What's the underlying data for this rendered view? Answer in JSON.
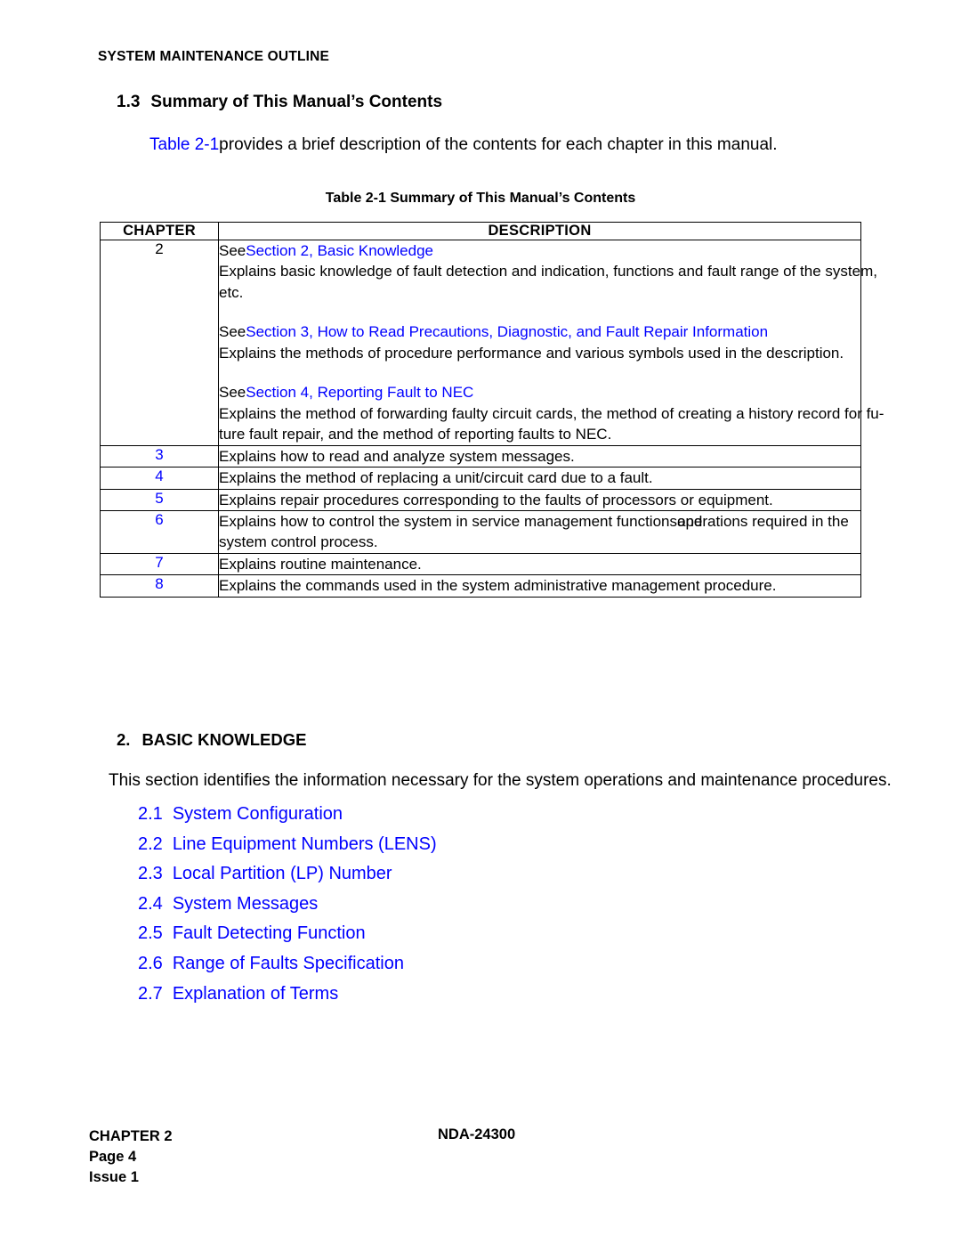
{
  "running_head": "SYSTEM MAINTENANCE OUTLINE",
  "section": {
    "number": "1.3",
    "title": "Summary of This Manual’s Contents"
  },
  "intro": {
    "link": "Table 2-1",
    "rest": "provides a brief description of the contents for each chapter in this manual."
  },
  "table": {
    "caption": "Table 2-1  Summary of This Manual’s Contents",
    "headers": {
      "chapter": "CHAPTER",
      "description": "DESCRIPTION"
    },
    "rows": [
      {
        "chapter": "2",
        "chapter_color": "#000000",
        "blocks": [
          {
            "see": "See",
            "link": "Section 2, Basic Knowledge",
            "lines": [
              "Explains basic knowledge of fault detection and indication, functions and fault range of the system,",
              "etc."
            ]
          },
          {
            "see": "See",
            "link": "Section 3, How to Read Precautions, Diagnostic, and Fault Repair Information",
            "lines": [
              "Explains the methods of procedure performance and various symbols used in the description."
            ]
          },
          {
            "see": "See",
            "link": "Section 4, Reporting Fault to NEC",
            "lines": [
              "Explains the method of forwarding faulty circuit cards, the method of creating a history record for fu-",
              "ture fault repair, and the method of reporting faults to NEC."
            ]
          }
        ]
      },
      {
        "chapter": "3",
        "chapter_color": "#0000ff",
        "lines": [
          "Explains how to read and analyze system messages."
        ]
      },
      {
        "chapter": "4",
        "chapter_color": "#0000ff",
        "lines": [
          "Explains the method of replacing a unit/circuit card due to a fault."
        ]
      },
      {
        "chapter": "5",
        "chapter_color": "#0000ff",
        "lines": [
          "Explains repair procedures corresponding to the faults of processors or equipment."
        ]
      },
      {
        "chapter": "6",
        "chapter_color": "#0000ff",
        "overlap": {
          "before": "Explains how to control the system in service management functions",
          "text_a": "and",
          "text_b": "operations required in the"
        },
        "lines_after": [
          "system control process."
        ]
      },
      {
        "chapter": "7",
        "chapter_color": "#0000ff",
        "lines": [
          "Explains routine maintenance."
        ]
      },
      {
        "chapter": "8",
        "chapter_color": "#0000ff",
        "lines": [
          "Explains the commands used in the system administrative management procedure."
        ]
      }
    ]
  },
  "chapter2": {
    "number": "2.",
    "title": "BASIC KNOWLEDGE",
    "paragraph": "This section identifies the information necessary for the system operations and maintenance procedures.",
    "toc": [
      {
        "num": "2.1",
        "label": "System Configuration"
      },
      {
        "num": "2.2",
        "label": "Line Equipment Numbers (LENS)"
      },
      {
        "num": "2.3",
        "label": "Local Partition (LP) Number"
      },
      {
        "num": "2.4",
        "label": "System Messages"
      },
      {
        "num": "2.5",
        "label": "Fault Detecting Function"
      },
      {
        "num": "2.6",
        "label": "Range of Faults Specification"
      },
      {
        "num": "2.7",
        "label": "Explanation of Terms"
      }
    ]
  },
  "footer": {
    "chapter": "CHAPTER 2",
    "page": "Page 4",
    "issue": "Issue 1",
    "doc": "NDA-24300"
  },
  "colors": {
    "link": "#0000ff",
    "text": "#000000",
    "background": "#ffffff"
  }
}
